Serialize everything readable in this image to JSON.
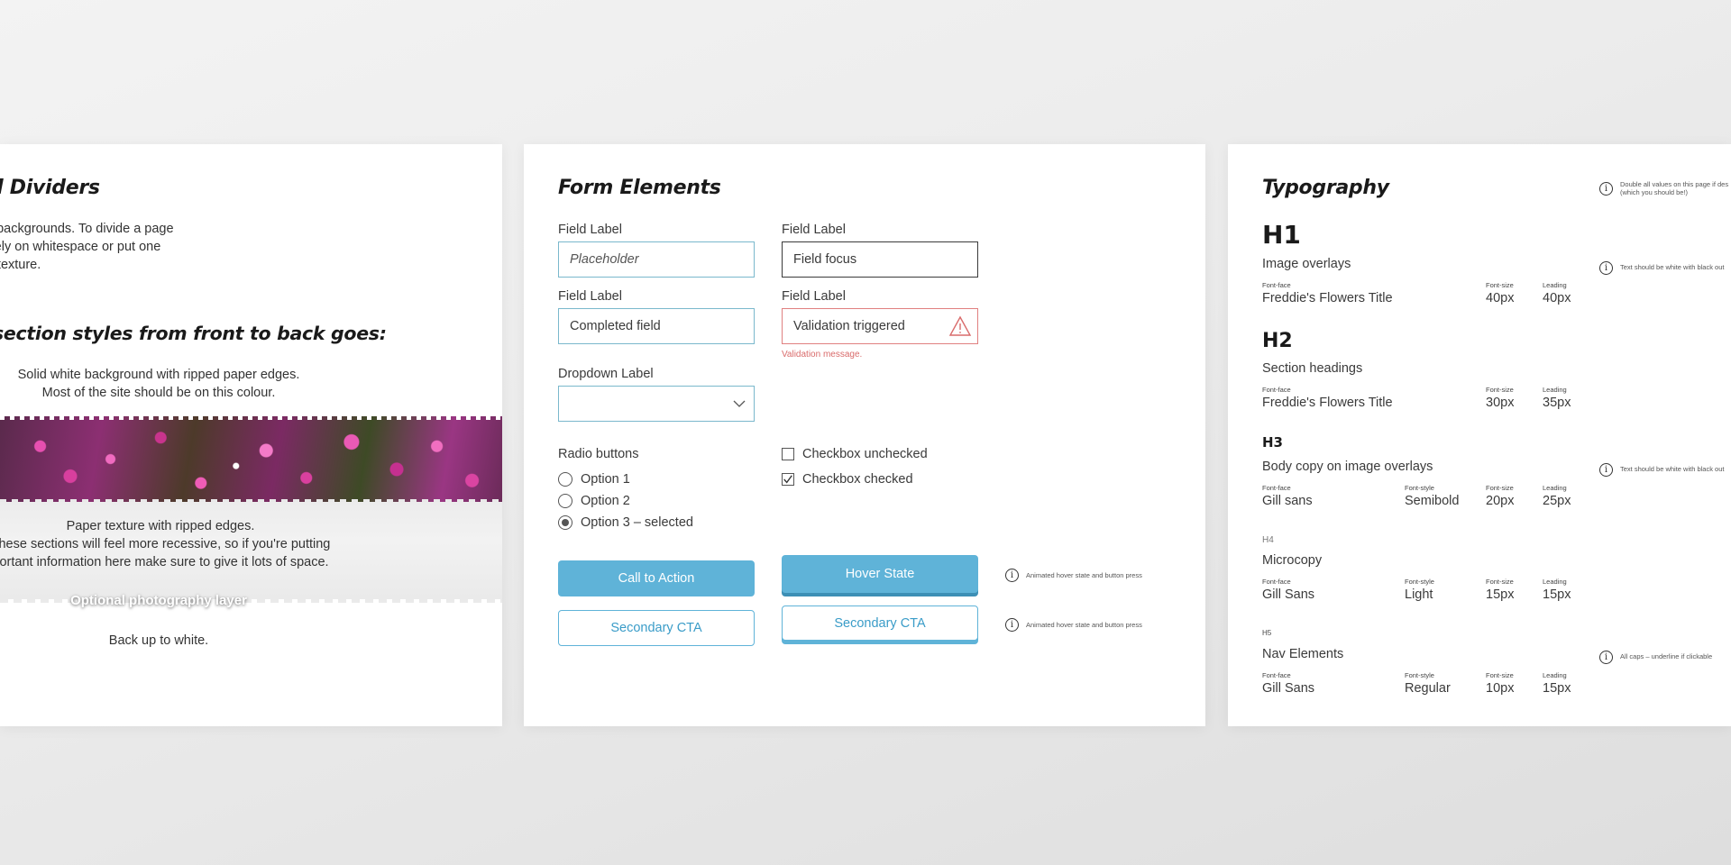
{
  "dividers": {
    "title": "d Dividers",
    "intro_lines": [
      "te backgrounds. To divide a page",
      "r rely on whitespace or put one",
      "er texture."
    ],
    "section_title": "section styles from front to back goes:",
    "solid_lines": [
      "Solid white background with ripped paper edges.",
      "Most of the site should be on this colour."
    ],
    "photo_label": "Optional photography layer",
    "paper_lines": [
      "Paper texture with ripped edges.",
      "These sections will feel more recessive, so if you're putting",
      "portant information here make sure to give it lots of space."
    ],
    "white_text": "Back up to white."
  },
  "forms": {
    "title": "Form Elements",
    "field1": {
      "label": "Field Label",
      "placeholder": "Placeholder"
    },
    "field2": {
      "label": "Field Label",
      "value": "Field focus"
    },
    "field3": {
      "label": "Field Label",
      "value": "Completed field"
    },
    "field4": {
      "label": "Field Label",
      "value": "Validation triggered",
      "error": "Validation message."
    },
    "dropdown": {
      "label": "Dropdown Label",
      "value": ""
    },
    "radios": {
      "label": "Radio buttons",
      "options": [
        "Option 1",
        "Option 2",
        "Option 3 – selected"
      ],
      "selected_index": 2
    },
    "checkboxes": [
      {
        "label": "Checkbox unchecked",
        "checked": false
      },
      {
        "label": "Checkbox checked",
        "checked": true
      }
    ],
    "buttons": {
      "cta": "Call to Action",
      "hover": "Hover State",
      "secondary": "Secondary CTA",
      "secondary_hover": "Secondary CTA",
      "note1": "Animated hover state and button press",
      "note2": "Animated hover state and button press"
    },
    "colors": {
      "accent": "#5fb3d8",
      "field_border": "#7ab8cc",
      "error": "#d96b6b"
    }
  },
  "typography": {
    "title": "Typography",
    "notes": {
      "top": [
        "Double all values on this page if des",
        "(which you should be!)"
      ],
      "h1": "Text should be white with black out",
      "h3": "Text should be white with black out",
      "h5": "All caps – underline if clickable"
    },
    "styles": [
      {
        "mark": "H1",
        "desc": "Image overlays",
        "face_key": "Font-face",
        "face": "Freddie's Flowers Title",
        "style_key": "",
        "style": "",
        "size_key": "Font-size",
        "size": "40px",
        "lead_key": "Leading",
        "lead": "40px"
      },
      {
        "mark": "H2",
        "desc": "Section headings",
        "face_key": "Font-face",
        "face": "Freddie's Flowers Title",
        "style_key": "",
        "style": "",
        "size_key": "Font-size",
        "size": "30px",
        "lead_key": "Leading",
        "lead": "35px"
      },
      {
        "mark": "H3",
        "desc": "Body copy on image overlays",
        "face_key": "Font-face",
        "face": "Gill sans",
        "style_key": "Font-style",
        "style": "Semibold",
        "size_key": "Font-size",
        "size": "20px",
        "lead_key": "Leading",
        "lead": "25px"
      },
      {
        "mark": "H4",
        "desc": "Microcopy",
        "face_key": "Font-face",
        "face": "Gill Sans",
        "style_key": "Font-style",
        "style": "Light",
        "size_key": "Font-size",
        "size": "15px",
        "lead_key": "Leading",
        "lead": "15px"
      },
      {
        "mark": "H5",
        "desc": "Nav Elements",
        "face_key": "Font-face",
        "face": "Gill Sans",
        "style_key": "Font-style",
        "style": "Regular",
        "size_key": "Font-size",
        "size": "10px",
        "lead_key": "Leading",
        "lead": "15px"
      }
    ]
  }
}
